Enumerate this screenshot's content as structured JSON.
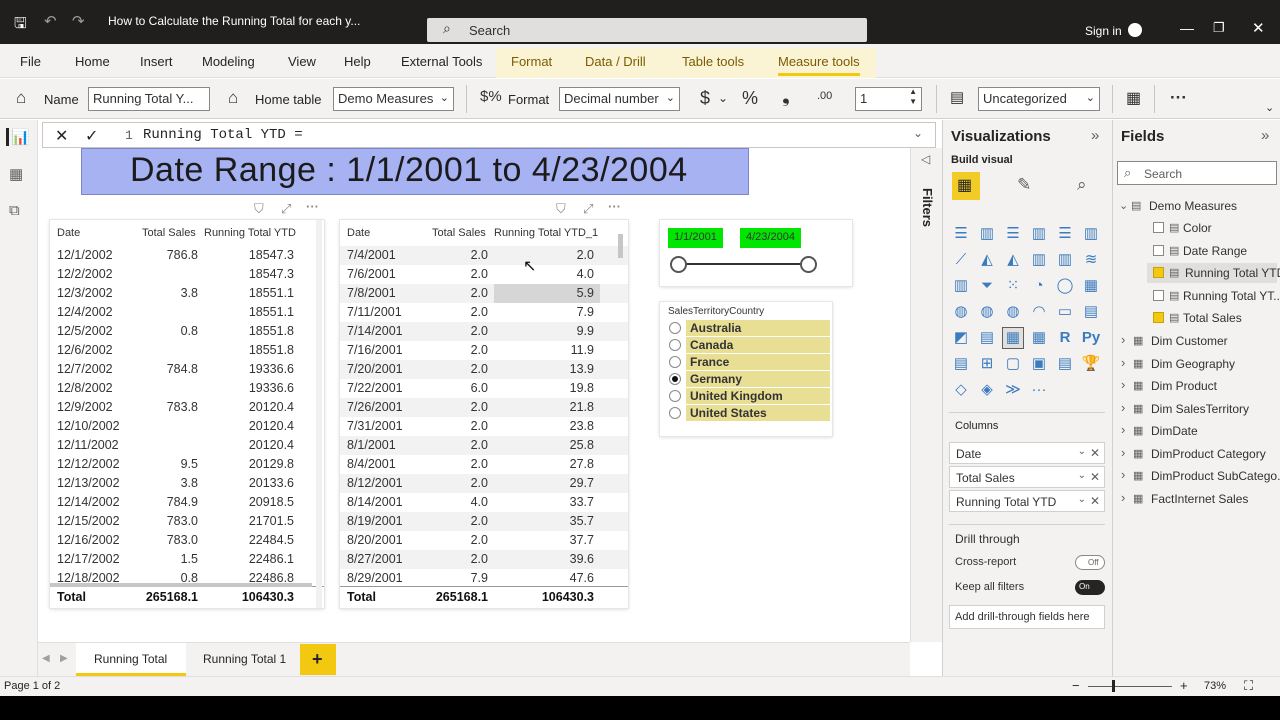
{
  "titlebar": {
    "doc_title": "How to Calculate the Running Total for each y...",
    "search_placeholder": "Search",
    "sign_in": "Sign in"
  },
  "ribbon_tabs": [
    "File",
    "Home",
    "Insert",
    "Modeling",
    "View",
    "Help",
    "External Tools",
    "Format",
    "Data / Drill",
    "Table tools",
    "Measure tools"
  ],
  "active_tab": "Measure tools",
  "ribbon": {
    "name_label": "Name",
    "name_value": "Running Total Y...",
    "home_table_label": "Home table",
    "home_table_value": "Demo Measures",
    "format_label": "Format",
    "format_value": "Decimal number",
    "currency_symbol": "$",
    "percent_symbol": "%",
    "comma_symbol": "❟",
    "decimals_value": "1",
    "category_value": "Uncategorized"
  },
  "formula": {
    "line_no": "1",
    "text": "Running Total YTD ="
  },
  "date_range_title": "Date Range : 1/1/2001 to 4/23/2004",
  "table1": {
    "headers": [
      "Date",
      "Total Sales",
      "Running Total YTD"
    ],
    "rows": [
      [
        "12/1/2002",
        "786.8",
        "18547.3"
      ],
      [
        "12/2/2002",
        "",
        "18547.3"
      ],
      [
        "12/3/2002",
        "3.8",
        "18551.1"
      ],
      [
        "12/4/2002",
        "",
        "18551.1"
      ],
      [
        "12/5/2002",
        "0.8",
        "18551.8"
      ],
      [
        "12/6/2002",
        "",
        "18551.8"
      ],
      [
        "12/7/2002",
        "784.8",
        "19336.6"
      ],
      [
        "12/8/2002",
        "",
        "19336.6"
      ],
      [
        "12/9/2002",
        "783.8",
        "20120.4"
      ],
      [
        "12/10/2002",
        "",
        "20120.4"
      ],
      [
        "12/11/2002",
        "",
        "20120.4"
      ],
      [
        "12/12/2002",
        "9.5",
        "20129.8"
      ],
      [
        "12/13/2002",
        "3.8",
        "20133.6"
      ],
      [
        "12/14/2002",
        "784.9",
        "20918.5"
      ],
      [
        "12/15/2002",
        "783.0",
        "21701.5"
      ],
      [
        "12/16/2002",
        "783.0",
        "22484.5"
      ],
      [
        "12/17/2002",
        "1.5",
        "22486.1"
      ],
      [
        "12/18/2002",
        "0.8",
        "22486.8"
      ]
    ],
    "total": [
      "Total",
      "265168.1",
      "106430.3"
    ]
  },
  "table2": {
    "headers": [
      "Date",
      "Total Sales",
      "Running Total YTD_1"
    ],
    "rows": [
      [
        "7/4/2001",
        "2.0",
        "2.0"
      ],
      [
        "7/6/2001",
        "2.0",
        "4.0"
      ],
      [
        "7/8/2001",
        "2.0",
        "5.9"
      ],
      [
        "7/11/2001",
        "2.0",
        "7.9"
      ],
      [
        "7/14/2001",
        "2.0",
        "9.9"
      ],
      [
        "7/16/2001",
        "2.0",
        "11.9"
      ],
      [
        "7/20/2001",
        "2.0",
        "13.9"
      ],
      [
        "7/22/2001",
        "6.0",
        "19.8"
      ],
      [
        "7/26/2001",
        "2.0",
        "21.8"
      ],
      [
        "7/31/2001",
        "2.0",
        "23.8"
      ],
      [
        "8/1/2001",
        "2.0",
        "25.8"
      ],
      [
        "8/4/2001",
        "2.0",
        "27.8"
      ],
      [
        "8/12/2001",
        "2.0",
        "29.7"
      ],
      [
        "8/14/2001",
        "4.0",
        "33.7"
      ],
      [
        "8/19/2001",
        "2.0",
        "35.7"
      ],
      [
        "8/20/2001",
        "2.0",
        "37.7"
      ],
      [
        "8/27/2001",
        "2.0",
        "39.6"
      ],
      [
        "8/29/2001",
        "7.9",
        "47.6"
      ]
    ],
    "total": [
      "Total",
      "265168.1",
      "106430.3"
    ]
  },
  "date_slicer": {
    "start": "1/1/2001",
    "end": "4/23/2004",
    "chip_color": "#00e600"
  },
  "country_slicer": {
    "title": "SalesTerritoryCountry",
    "items": [
      "Australia",
      "Canada",
      "France",
      "Germany",
      "United Kingdom",
      "United States"
    ],
    "selected": "Germany",
    "highlight_color": "#e8de94"
  },
  "filters_label": "Filters",
  "viz_pane": {
    "title": "Visualizations",
    "build_visual": "Build visual",
    "columns_label": "Columns",
    "wells": [
      "Date",
      "Total Sales",
      "Running Total YTD"
    ],
    "drill_through": "Drill through",
    "cross_report": "Cross-report",
    "cross_report_state": "Off",
    "keep_filters": "Keep all filters",
    "keep_filters_state": "On",
    "add_drill": "Add drill-through fields here"
  },
  "fields_pane": {
    "title": "Fields",
    "search_placeholder": "Search",
    "demo_measures": "Demo Measures",
    "measures": [
      {
        "label": "Color",
        "checked": false
      },
      {
        "label": "Date Range",
        "checked": false
      },
      {
        "label": "Running Total YTD",
        "checked": true
      },
      {
        "label": "Running Total YT...",
        "checked": false
      },
      {
        "label": "Total Sales",
        "checked": true
      }
    ],
    "tables": [
      "Dim Customer",
      "Dim Geography",
      "Dim Product",
      "Dim SalesTerritory",
      "DimDate",
      "DimProduct Category",
      "DimProduct SubCatego...",
      "FactInternet Sales"
    ]
  },
  "page_tabs": [
    "Running Total",
    "Running Total 1"
  ],
  "active_page": "Running Total",
  "add_page": "+",
  "status": {
    "page_info": "Page 1 of 2",
    "zoom": "73%"
  }
}
